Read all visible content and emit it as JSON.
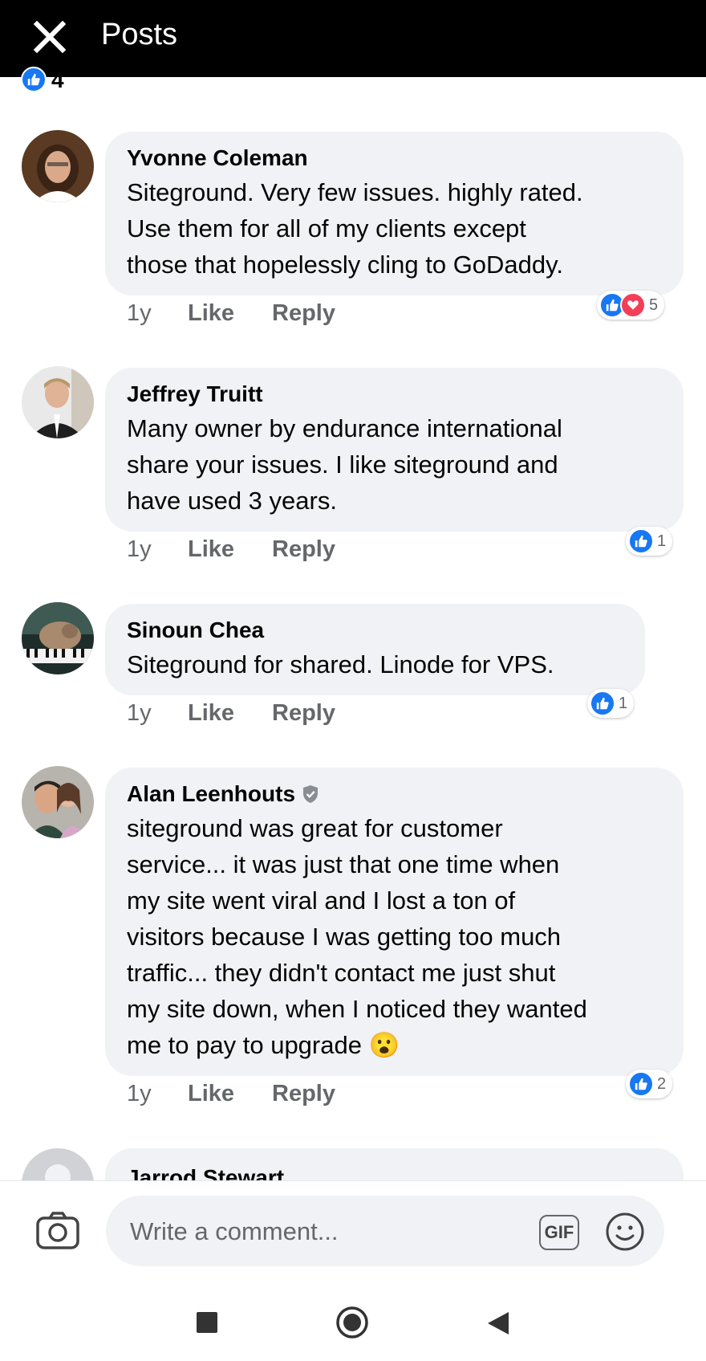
{
  "header": {
    "title": "Posts"
  },
  "post_reactions": {
    "count": "4"
  },
  "comments": [
    {
      "author": "Yvonne Coleman",
      "text": "Siteground. Very few issues. highly rated.\nUse them for all of my clients except\nthose that hopelessly cling to GoDaddy.",
      "time": "1y",
      "like": "Like",
      "reply": "Reply",
      "reaction_count": "5",
      "reactions": [
        "like-icon",
        "love-icon"
      ]
    },
    {
      "author": "Jeffrey Truitt",
      "text": "Many owner by endurance international\nshare your issues. I like siteground and\nhave used 3 years.",
      "time": "1y",
      "like": "Like",
      "reply": "Reply",
      "reaction_count": "1",
      "reactions": [
        "like-icon"
      ]
    },
    {
      "author": "Sinoun Chea",
      "text": "Siteground for shared. Linode for VPS.",
      "time": "1y",
      "like": "Like",
      "reply": "Reply",
      "reaction_count": "1",
      "reactions": [
        "like-icon"
      ]
    },
    {
      "author": "Alan Leenhouts",
      "verified": true,
      "text": "siteground was great for customer\nservice... it was just that one time when\nmy site went viral and I lost a ton of\nvisitors because I was getting too much\ntraffic... they didn't contact me just shut\nmy site down, when I noticed they wanted\nme to pay to upgrade",
      "emoji": "😮",
      "time": "1y",
      "like": "Like",
      "reply": "Reply",
      "reaction_count": "2",
      "reactions": [
        "like-icon"
      ]
    },
    {
      "author": "Jarrod Stewart"
    }
  ],
  "composer": {
    "placeholder": "Write a comment...",
    "gif_label": "GIF"
  },
  "colors": {
    "accent": "#1877f2",
    "love": "#f33e58",
    "bubble": "#f0f2f5",
    "muted": "#65676b"
  }
}
